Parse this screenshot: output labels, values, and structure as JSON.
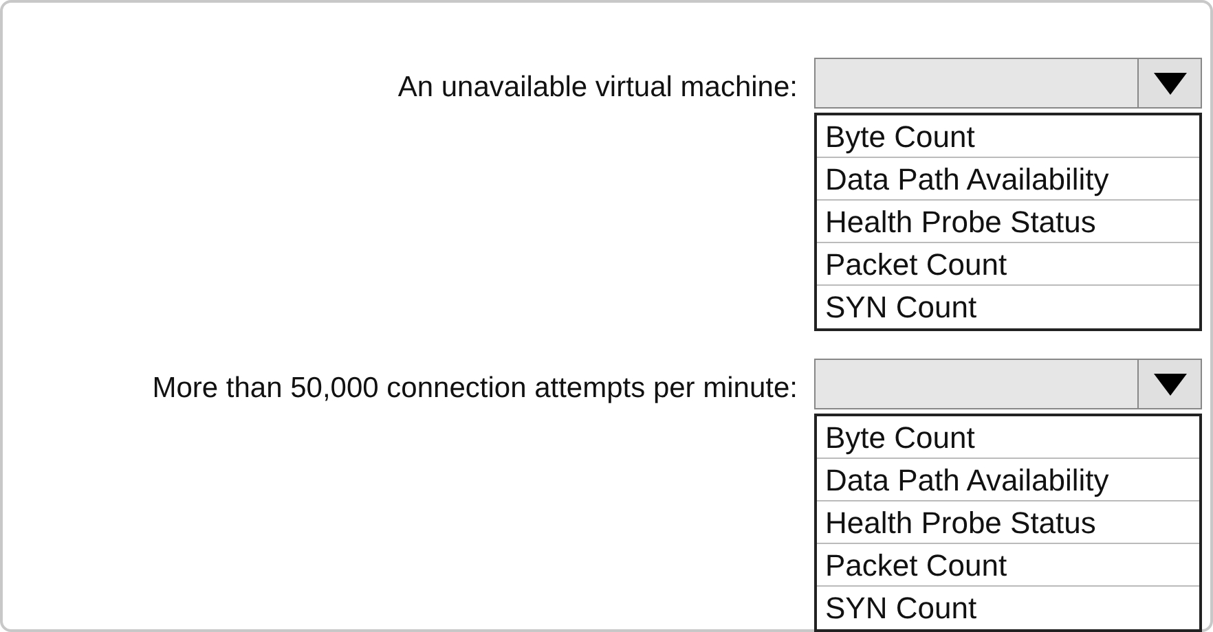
{
  "questions": [
    {
      "label": "An unavailable virtual machine:",
      "dropdown": {
        "options": [
          {
            "label": "Byte Count",
            "selected": false
          },
          {
            "label": "Data Path Availability",
            "selected": false
          },
          {
            "label": "Health Probe Status",
            "selected": false
          },
          {
            "label": "Packet Count",
            "selected": false
          },
          {
            "label": "SYN Count",
            "selected": false
          }
        ]
      }
    },
    {
      "label": "More than 50,000 connection attempts per minute:",
      "dropdown": {
        "options": [
          {
            "label": "Byte Count",
            "selected": false
          },
          {
            "label": "Data Path Availability",
            "selected": false
          },
          {
            "label": "Health Probe Status",
            "selected": false
          },
          {
            "label": "Packet Count",
            "selected": false
          },
          {
            "label": "SYN Count",
            "selected": false
          }
        ]
      }
    }
  ]
}
